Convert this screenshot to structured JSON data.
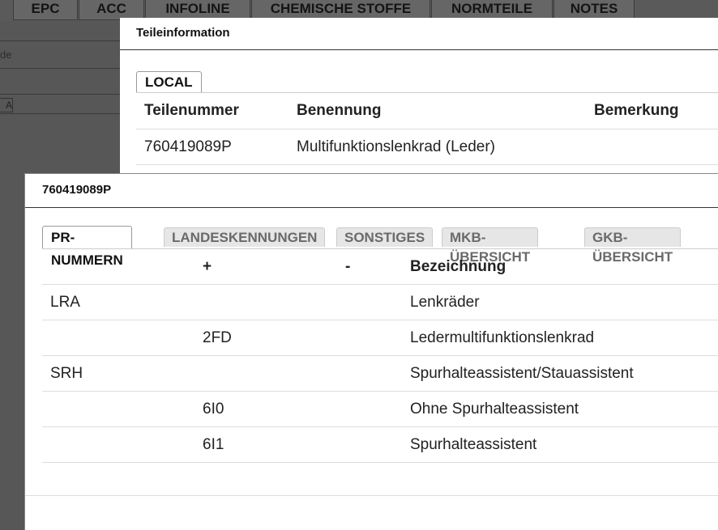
{
  "background": {
    "tabs": [
      {
        "label": "EPC"
      },
      {
        "label": "ACC"
      },
      {
        "label": "INFOLINE"
      },
      {
        "label": "CHEMISCHE STOFFE"
      },
      {
        "label": "NORMTEILE"
      },
      {
        "label": "NOTES"
      }
    ],
    "field_label": "de",
    "chip": "A"
  },
  "teileinformation": {
    "title": "Teileinformation",
    "tab": "LOCAL",
    "columns": [
      "Teilenummer",
      "Benennung",
      "Bemerkung"
    ],
    "rows": [
      {
        "teilenummer": "760419089P",
        "benennung": "Multifunktionslenkrad (Leder)",
        "bemerkung": ""
      }
    ]
  },
  "part_dialog": {
    "title": "760419089P",
    "tabs": [
      {
        "label": "PR-NUMMERN",
        "active": true
      },
      {
        "label": "LANDESKENNUNGEN",
        "active": false
      },
      {
        "label": "SONSTIGES",
        "active": false
      },
      {
        "label": "MKB-ÜBERSICHT",
        "active": false
      },
      {
        "label": "GKB-ÜBERSICHT",
        "active": false
      }
    ],
    "columns": [
      "",
      "+",
      "-",
      "Bezeichnung"
    ],
    "rows": [
      {
        "family": "LRA",
        "plus": "",
        "minus": "",
        "bezeichnung": "Lenkräder"
      },
      {
        "family": "",
        "plus": "2FD",
        "minus": "",
        "bezeichnung": "Ledermultifunktionslenkrad"
      },
      {
        "family": "SRH",
        "plus": "",
        "minus": "",
        "bezeichnung": "Spurhalteassistent/Stauassistent"
      },
      {
        "family": "",
        "plus": "6I0",
        "minus": "",
        "bezeichnung": "Ohne Spurhalteassistent"
      },
      {
        "family": "",
        "plus": "6I1",
        "minus": "",
        "bezeichnung": "Spurhalteassistent"
      }
    ]
  }
}
